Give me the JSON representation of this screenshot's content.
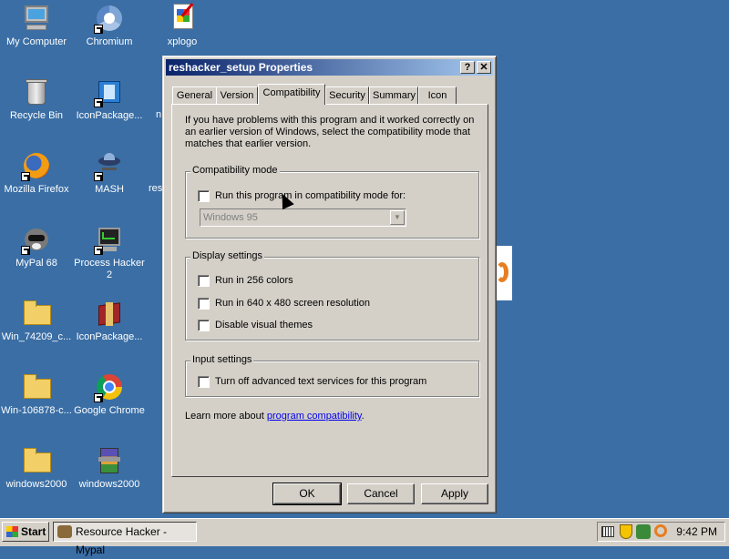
{
  "desktop": {
    "icons": [
      {
        "label": "My Computer"
      },
      {
        "label": "Chromium"
      },
      {
        "label": "xplogo"
      },
      {
        "label": "Recycle Bin"
      },
      {
        "label": "IconPackage..."
      },
      {
        "label": "Mozilla Firefox"
      },
      {
        "label": "MASH"
      },
      {
        "label": "MyPal 68"
      },
      {
        "label": "Process Hacker 2"
      },
      {
        "label": "Win_74209_c..."
      },
      {
        "label": "IconPackage..."
      },
      {
        "label": "Win-106878-c..."
      },
      {
        "label": "Google Chrome"
      },
      {
        "label": "windows2000"
      },
      {
        "label": "windows2000"
      }
    ]
  },
  "dialog": {
    "title": "reshacker_setup Properties",
    "help_btn": "?",
    "close_btn": "✕",
    "tabs": [
      "General",
      "Version",
      "Compatibility",
      "Security",
      "Summary",
      "Icon"
    ],
    "active_tab": "Compatibility",
    "intro": "If you have problems with this program and it worked correctly on an earlier version of Windows, select the compatibility mode that matches that earlier version.",
    "compat_group": "Compatibility mode",
    "compat_check": "Run this program in compatibility mode for:",
    "compat_select": "Windows 95",
    "display_group": "Display settings",
    "display_checks": [
      "Run in 256 colors",
      "Run in 640 x 480 screen resolution",
      "Disable visual themes"
    ],
    "input_group": "Input settings",
    "input_check": "Turn off advanced text services for this program",
    "learn_text": "Learn more about ",
    "learn_link": "program compatibility",
    "learn_end": ".",
    "buttons": {
      "ok": "OK",
      "cancel": "Cancel",
      "apply": "Apply"
    }
  },
  "taskbar": {
    "start": "Start",
    "task": "Resource Hacker - Mypal",
    "clock": "9:42 PM"
  },
  "colors": {
    "desktop": "#3a6ea5",
    "title_start": "#0a246a",
    "title_end": "#a6caf0",
    "face": "#d4d0c8"
  }
}
